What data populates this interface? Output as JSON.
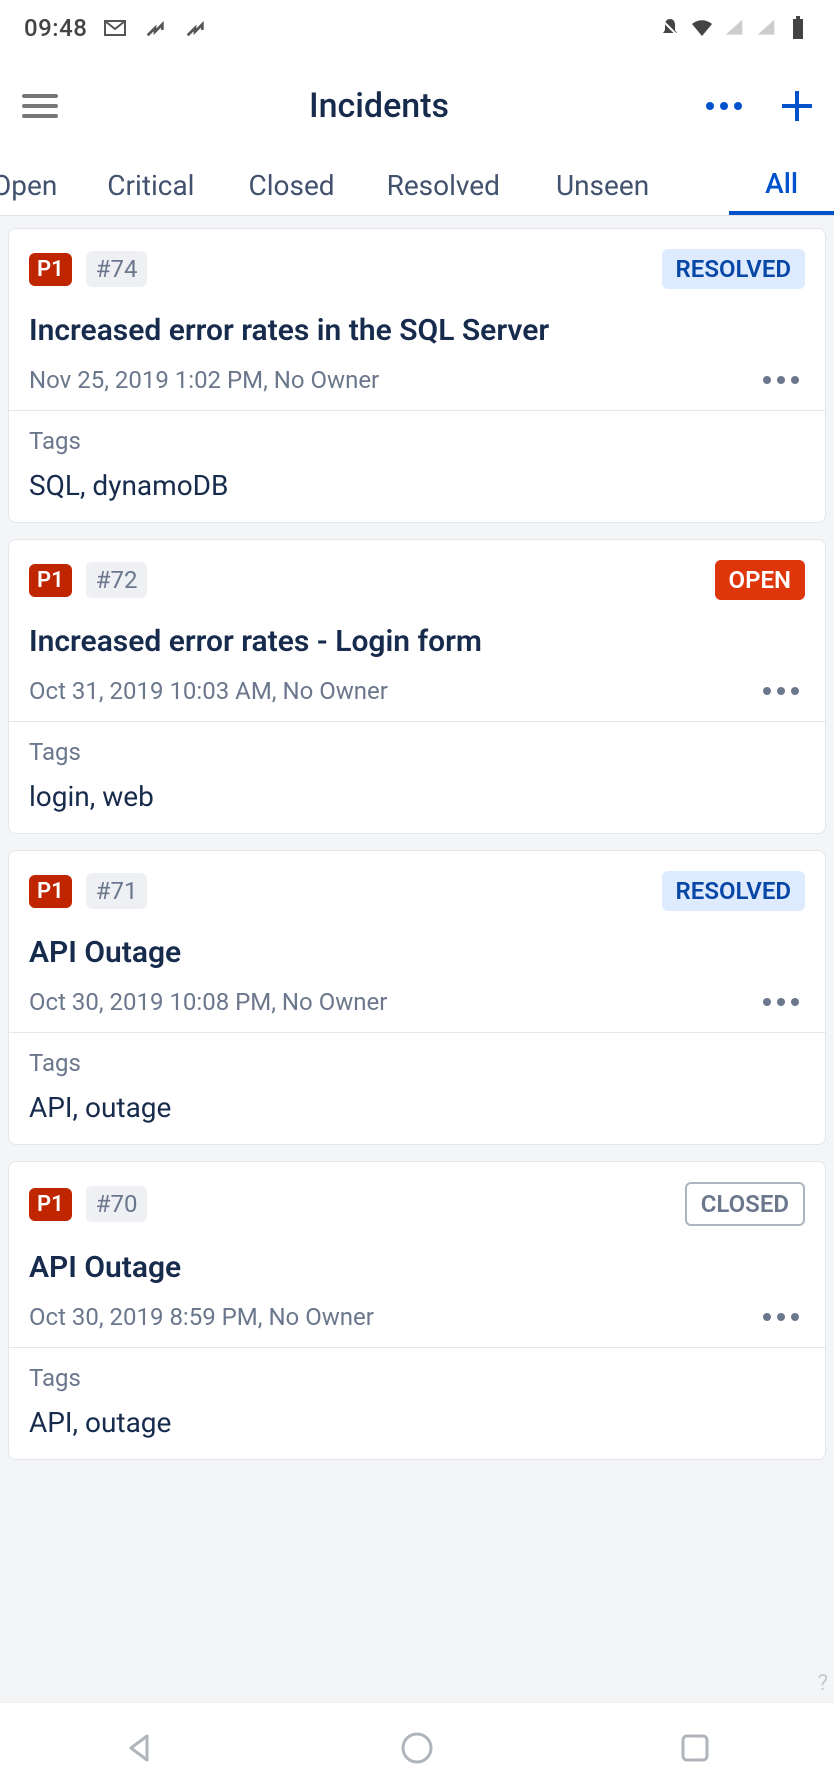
{
  "statusBar": {
    "time": "09:48"
  },
  "header": {
    "title": "Incidents"
  },
  "tabs": [
    {
      "label": "Open",
      "active": false
    },
    {
      "label": "Critical",
      "active": false
    },
    {
      "label": "Closed",
      "active": false
    },
    {
      "label": "Resolved",
      "active": false
    },
    {
      "label": "Unseen",
      "active": false
    },
    {
      "label": "All",
      "active": true
    }
  ],
  "tagsLabel": "Tags",
  "incidents": [
    {
      "priority": "P1",
      "id": "#74",
      "status": "RESOLVED",
      "statusType": "resolved",
      "title": "Increased error rates in the SQL Server",
      "meta": "Nov 25, 2019 1:02 PM, No Owner",
      "tags": "SQL, dynamoDB"
    },
    {
      "priority": "P1",
      "id": "#72",
      "status": "OPEN",
      "statusType": "open",
      "title": "Increased error rates - Login form",
      "meta": "Oct 31, 2019 10:03 AM, No Owner",
      "tags": "login, web"
    },
    {
      "priority": "P1",
      "id": "#71",
      "status": "RESOLVED",
      "statusType": "resolved",
      "title": "API Outage",
      "meta": "Oct 30, 2019 10:08 PM, No Owner",
      "tags": "API, outage"
    },
    {
      "priority": "P1",
      "id": "#70",
      "status": "CLOSED",
      "statusType": "closed",
      "title": "API Outage",
      "meta": "Oct 30, 2019 8:59 PM, No Owner",
      "tags": "API, outage"
    }
  ]
}
